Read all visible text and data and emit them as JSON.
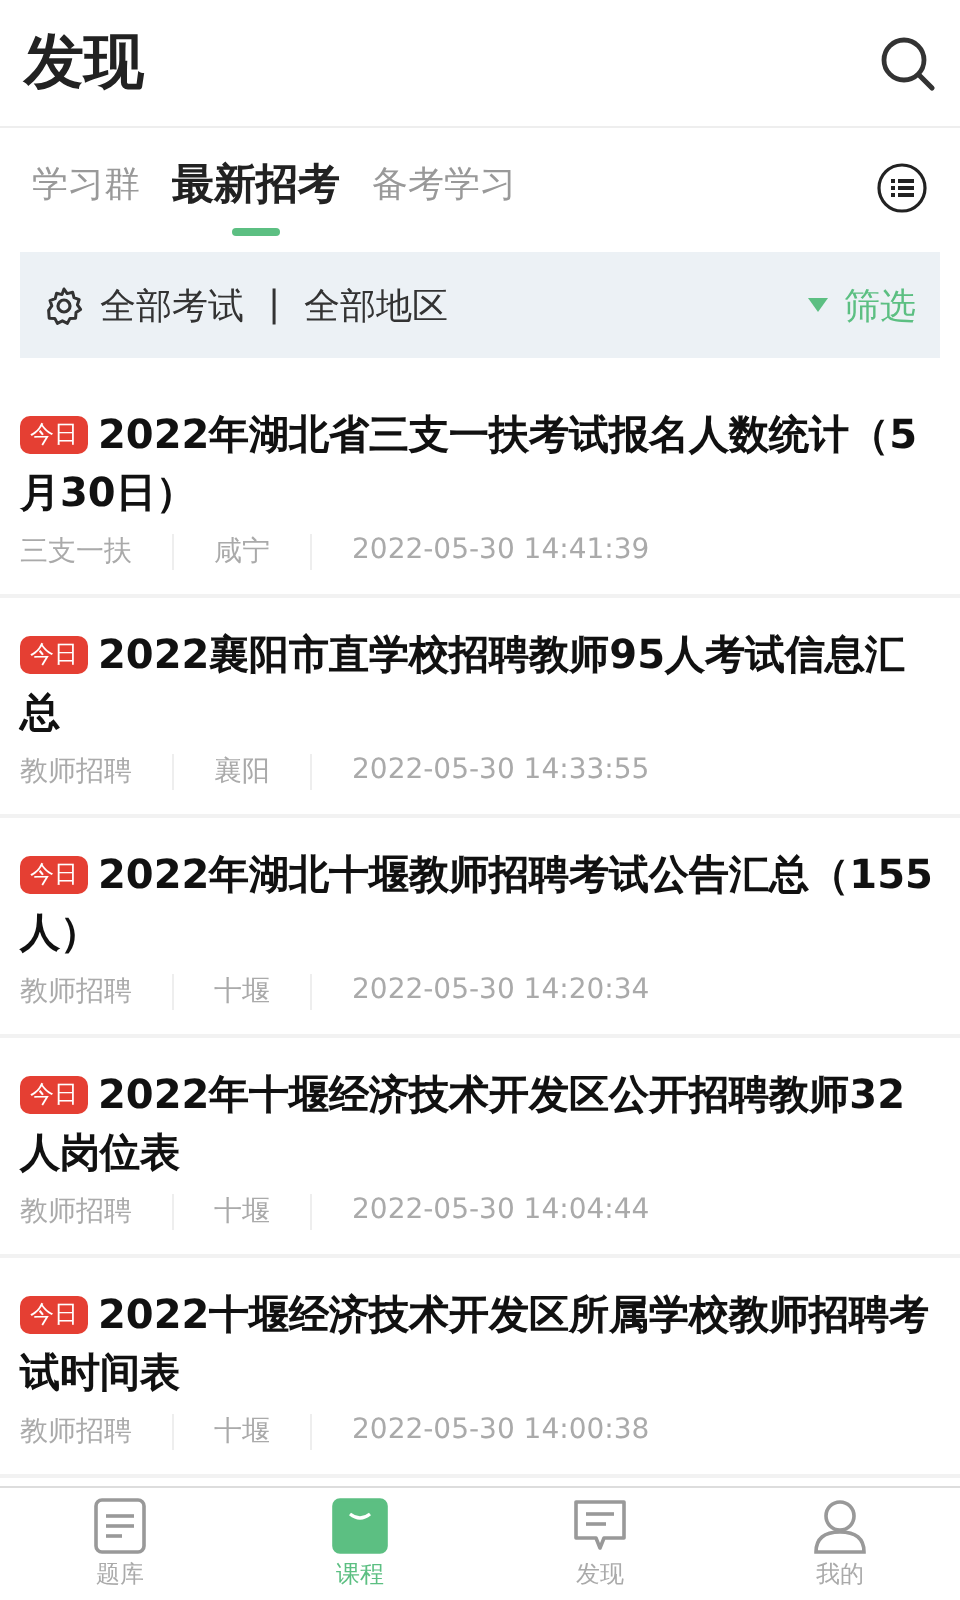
{
  "header": {
    "title": "发现"
  },
  "tabs": [
    {
      "label": "学习群",
      "selected": false
    },
    {
      "label": "最新招考",
      "selected": true
    },
    {
      "label": "备考学习",
      "selected": false
    }
  ],
  "filter": {
    "exam": "全部考试",
    "separator": "|",
    "region": "全部地区",
    "action": "筛选"
  },
  "articles": [
    {
      "badge": "今日",
      "title": "2022年湖北省三支一扶考试报名人数统计（5月30日）",
      "category": "三支一扶",
      "region": "咸宁",
      "time": "2022-05-30 14:41:39"
    },
    {
      "badge": "今日",
      "title": "2022襄阳市直学校招聘教师95人考试信息汇总",
      "category": "教师招聘",
      "region": "襄阳",
      "time": "2022-05-30 14:33:55"
    },
    {
      "badge": "今日",
      "title": "2022年湖北十堰教师招聘考试公告汇总（155人）",
      "category": "教师招聘",
      "region": "十堰",
      "time": "2022-05-30 14:20:34"
    },
    {
      "badge": "今日",
      "title": "2022年十堰经济技术开发区公开招聘教师32人岗位表",
      "category": "教师招聘",
      "region": "十堰",
      "time": "2022-05-30 14:04:44"
    },
    {
      "badge": "今日",
      "title": "2022十堰经济技术开发区所属学校教师招聘考试时间表",
      "category": "教师招聘",
      "region": "十堰",
      "time": "2022-05-30 14:00:38"
    }
  ],
  "bottom_nav": [
    {
      "kind": "list",
      "label": "题库",
      "selected": false
    },
    {
      "kind": "bag",
      "label": "课程",
      "selected": true
    },
    {
      "kind": "chat",
      "label": "发现",
      "selected": false
    },
    {
      "kind": "person",
      "label": "我的",
      "selected": false
    }
  ]
}
